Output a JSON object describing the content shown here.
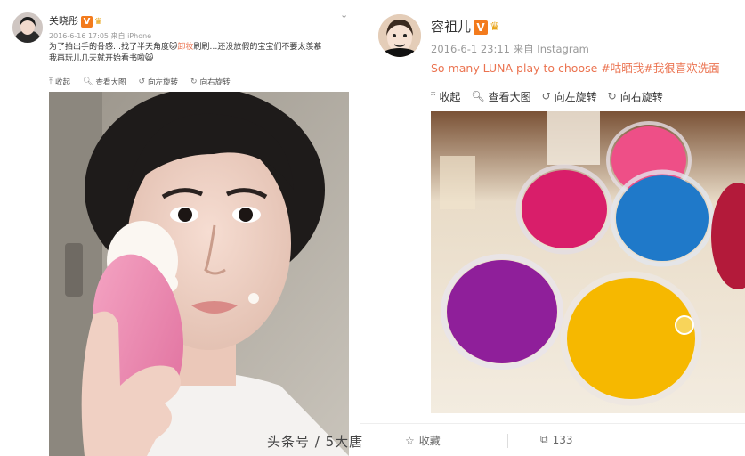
{
  "left_post": {
    "username": "关晓彤",
    "verified_badge": "V",
    "meta": "2016-6-16 17:05 来自 iPhone",
    "text_before": "为了拍出手的骨感…找了半天角度",
    "text_link": "卸妆",
    "text_after": "刷刷…还没放假的宝宝们不要太羡慕",
    "text_line2": "我再玩儿几天就开始看书啦",
    "toolbar": {
      "collect": "收起",
      "view_large": "查看大图",
      "rotate_left": "向左旋转",
      "rotate_right": "向右旋转"
    },
    "icons": [
      "chevron-down-icon",
      "collapse-icon",
      "search-icon",
      "rotate-left-icon",
      "rotate-right-icon"
    ]
  },
  "right_post": {
    "username": "容祖儿",
    "verified_badge": "V",
    "meta": "2016-6-1 23:11 来自 Instagram",
    "text_plain": "So many LUNA play to choose ",
    "hashtag1": "#咕晒我",
    "hashtag2": "#我很喜欢洗面",
    "toolbar": {
      "collect": "收起",
      "view_large": "查看大图",
      "rotate_left": "向左旋转",
      "rotate_right": "向右旋转"
    },
    "footer": {
      "favorite": "收藏",
      "repost_count": "133"
    },
    "icons": [
      "collapse-icon",
      "search-icon",
      "rotate-left-icon",
      "rotate-right-icon",
      "star-icon",
      "repost-icon"
    ]
  },
  "watermark": "头条号 / 5大唐",
  "colors": {
    "link": "#eb7350",
    "verified": "#f37b1d",
    "page_bg": "#eeeeee"
  }
}
